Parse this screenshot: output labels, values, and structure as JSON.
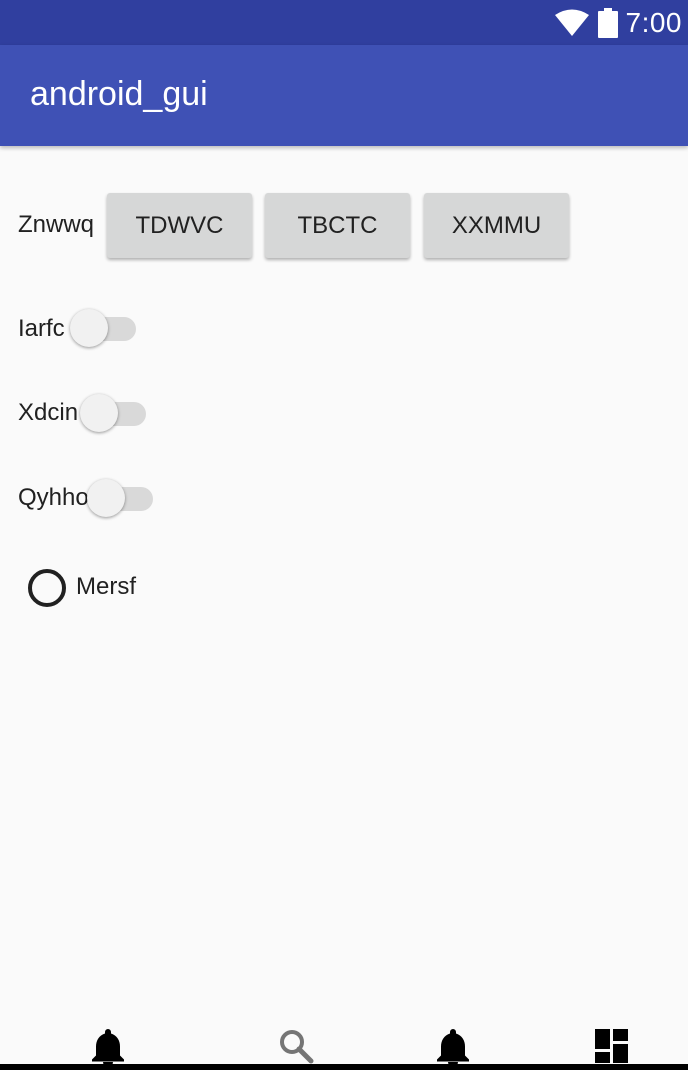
{
  "status_bar": {
    "time": "7:00",
    "icons": [
      "wifi-icon",
      "battery-icon"
    ]
  },
  "app_bar": {
    "title": "android_gui"
  },
  "button_row": {
    "label": "Znwwq",
    "buttons": [
      "TDWVC",
      "TBCTC",
      "XXMMU"
    ]
  },
  "switches": [
    {
      "label": "Iarfc",
      "checked": false
    },
    {
      "label": "Xdcin",
      "checked": false
    },
    {
      "label": "Qyhho",
      "checked": false
    }
  ],
  "radio": {
    "label": "Mersf",
    "checked": false
  },
  "bottom_nav": {
    "items": [
      "bell-icon",
      "search-icon",
      "bell-icon",
      "dashboard-icon"
    ]
  },
  "colors": {
    "status_bar": "#303f9f",
    "app_bar": "#3f51b5",
    "background": "#fafafa",
    "button": "#d6d7d7"
  }
}
